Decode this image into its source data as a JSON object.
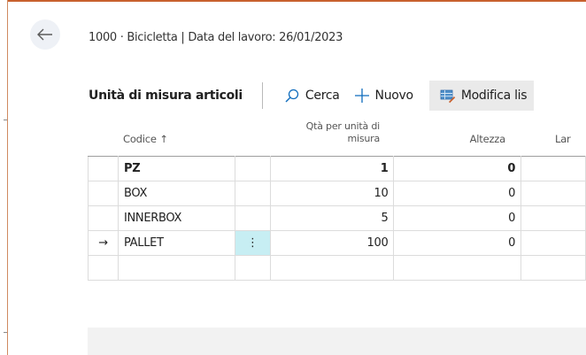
{
  "context": {
    "text": "1000 · Bicicletta | Data del lavoro: 26/01/2023"
  },
  "header": {
    "title": "Unità di misura articoli",
    "actions": {
      "search": "Cerca",
      "new": "Nuovo",
      "edit_list": "Modifica lis"
    }
  },
  "table": {
    "columns": {
      "code": "Codice",
      "code_sort": "↑",
      "qty_line1": "Qtà per unità di",
      "qty_line2": "misura",
      "height": "Altezza",
      "width": "Lar"
    },
    "rows": [
      {
        "code": "PZ",
        "qty": "1",
        "height": "0"
      },
      {
        "code": "BOX",
        "qty": "10",
        "height": "0"
      },
      {
        "code": "INNERBOX",
        "qty": "5",
        "height": "0"
      },
      {
        "code": "PALLET",
        "qty": "100",
        "height": "0",
        "current_marker": "→",
        "menu_glyph": "⋮"
      },
      {
        "code": "",
        "qty": "",
        "height": ""
      }
    ]
  },
  "icons": {
    "back": "back-arrow-icon",
    "search": "search-icon",
    "new": "plus-icon",
    "edit_list": "edit-list-icon"
  },
  "colors": {
    "frame_accent": "#c8612e",
    "action_blue": "#0f6cbd",
    "selected_cell": "#c7eef3",
    "back_button_bg": "#eef1f6"
  }
}
